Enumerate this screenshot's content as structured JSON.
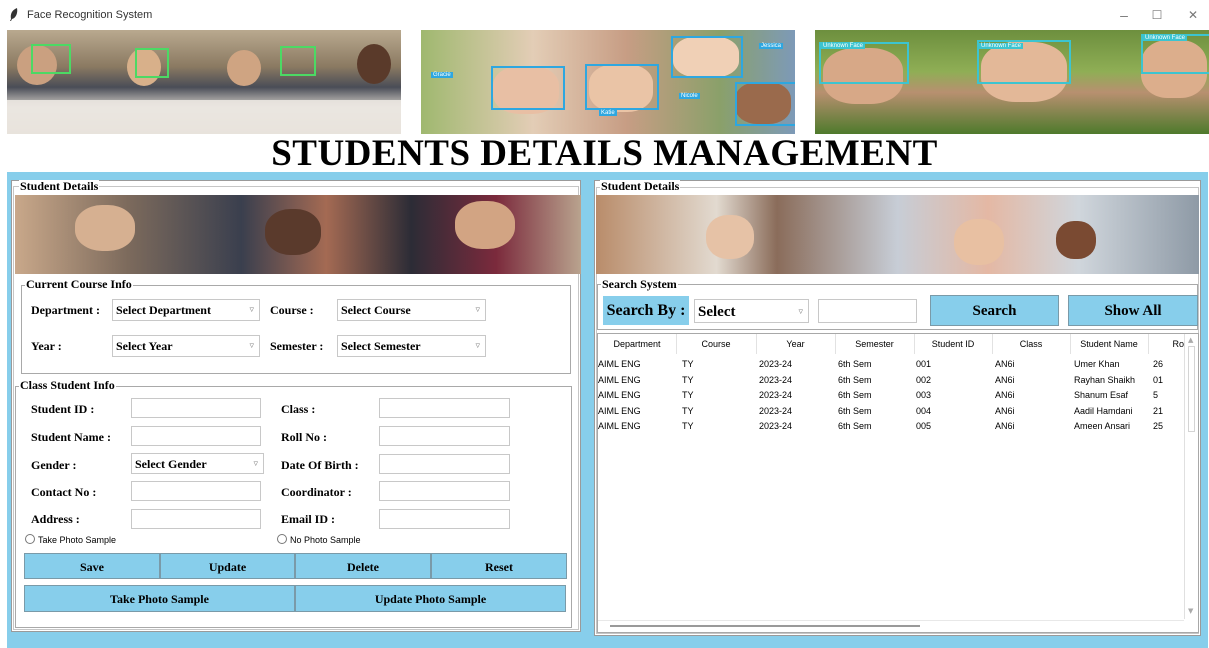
{
  "window": {
    "title": "Face Recognition System",
    "minimize": "–",
    "maximize": "☐",
    "close": "✕"
  },
  "banner": {
    "photo2_labels": [
      "Gracie",
      "Nicole",
      "Jessica",
      "Katie"
    ],
    "photo3_labels": [
      "Unknown Face",
      "Unknown Face",
      "Unknown Face"
    ]
  },
  "main_title": "STUDENTS DETAILS MANAGEMENT",
  "left": {
    "legend": "Student Details",
    "course": {
      "legend": "Current Course Info",
      "department_label": "Department :",
      "department_value": "Select Department",
      "course_label": "Course :",
      "course_value": "Select Course",
      "year_label": "Year :",
      "year_value": "Select Year",
      "semester_label": "Semester :",
      "semester_value": "Select Semester"
    },
    "class_info": {
      "legend": "Class Student Info",
      "student_id_label": "Student ID :",
      "class_label": "Class :",
      "student_name_label": "Student Name :",
      "roll_no_label": "Roll No :",
      "gender_label": "Gender :",
      "gender_value": "Select Gender",
      "dob_label": "Date Of Birth :",
      "contact_label": "Contact No :",
      "coordinator_label": "Coordinator :",
      "address_label": "Address :",
      "email_label": "Email ID :",
      "radio_take": "Take Photo Sample",
      "radio_no": "No Photo Sample"
    },
    "buttons": {
      "save": "Save",
      "update": "Update",
      "delete": "Delete",
      "reset": "Reset",
      "take_photo": "Take Photo Sample",
      "update_photo": "Update Photo Sample"
    }
  },
  "right": {
    "legend": "Student Details",
    "search": {
      "legend": "Search System",
      "search_by_label": "Search By :",
      "combo_value": "Select",
      "search_button": "Search",
      "show_all_button": "Show All"
    },
    "table": {
      "columns": [
        "Department",
        "Course",
        "Year",
        "Semester",
        "Student ID",
        "Class",
        "Student Name",
        "Ro"
      ],
      "rows": [
        [
          "AIML ENG",
          "TY",
          "2023-24",
          "6th Sem",
          "001",
          "AN6i",
          "Umer Khan",
          "26"
        ],
        [
          "AIML ENG",
          "TY",
          "2023-24",
          "6th Sem",
          "002",
          "AN6i",
          "Rayhan Shaikh",
          "01"
        ],
        [
          "AIML ENG",
          "TY",
          "2023-24",
          "6th Sem",
          "003",
          "AN6i",
          "Shanum Esaf",
          "5"
        ],
        [
          "AIML ENG",
          "TY",
          "2023-24",
          "6th Sem",
          "004",
          "AN6i",
          "Aadil Hamdani",
          "21"
        ],
        [
          "AIML ENG",
          "TY",
          "2023-24",
          "6th Sem",
          "005",
          "AN6i",
          "Ameen Ansari",
          "25"
        ]
      ]
    }
  },
  "colors": {
    "accent": "#87ceeb",
    "highlight": "#2ea7e0"
  }
}
